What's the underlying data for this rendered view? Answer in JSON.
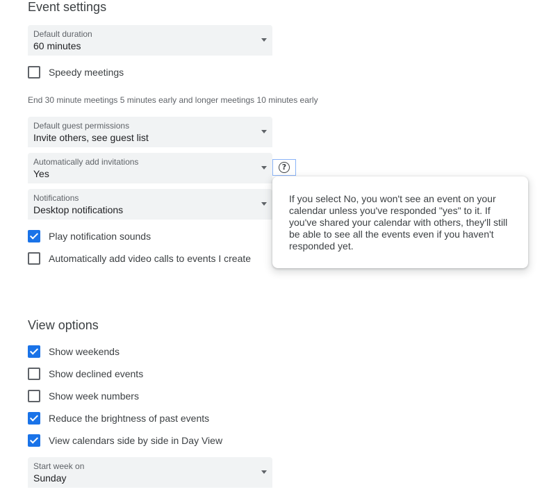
{
  "event_settings": {
    "title": "Event settings",
    "default_duration": {
      "label": "Default duration",
      "value": "60 minutes"
    },
    "speedy_meetings": {
      "label": "Speedy meetings",
      "checked": false
    },
    "speedy_helper": "End 30 minute meetings 5 minutes early and longer meetings 10 minutes early",
    "guest_permissions": {
      "label": "Default guest permissions",
      "value": "Invite others, see guest list"
    },
    "auto_add_invitations": {
      "label": "Automatically add invitations",
      "value": "Yes"
    },
    "notifications": {
      "label": "Notifications",
      "value": "Desktop notifications"
    },
    "play_sounds": {
      "label": "Play notification sounds",
      "checked": true
    },
    "auto_video_calls": {
      "label": "Automatically add video calls to events I create",
      "checked": false
    }
  },
  "help_tooltip": {
    "icon": "help-circle-icon",
    "text": "If you select No, you won't see an event on your calendar unless you've responded \"yes\" to it. If you've shared your calendar with others, they'll still be able to see all the events even if you haven't responded yet."
  },
  "view_options": {
    "title": "View options",
    "show_weekends": {
      "label": "Show weekends",
      "checked": true
    },
    "show_declined": {
      "label": "Show declined events",
      "checked": false
    },
    "show_week_numbers": {
      "label": "Show week numbers",
      "checked": false
    },
    "reduce_brightness": {
      "label": "Reduce the brightness of past events",
      "checked": true
    },
    "side_by_side": {
      "label": "View calendars side by side in Day View",
      "checked": true
    },
    "start_week_on": {
      "label": "Start week on",
      "value": "Sunday"
    }
  },
  "colors": {
    "accent": "#1a73e8",
    "field_bg": "#f1f3f4"
  }
}
